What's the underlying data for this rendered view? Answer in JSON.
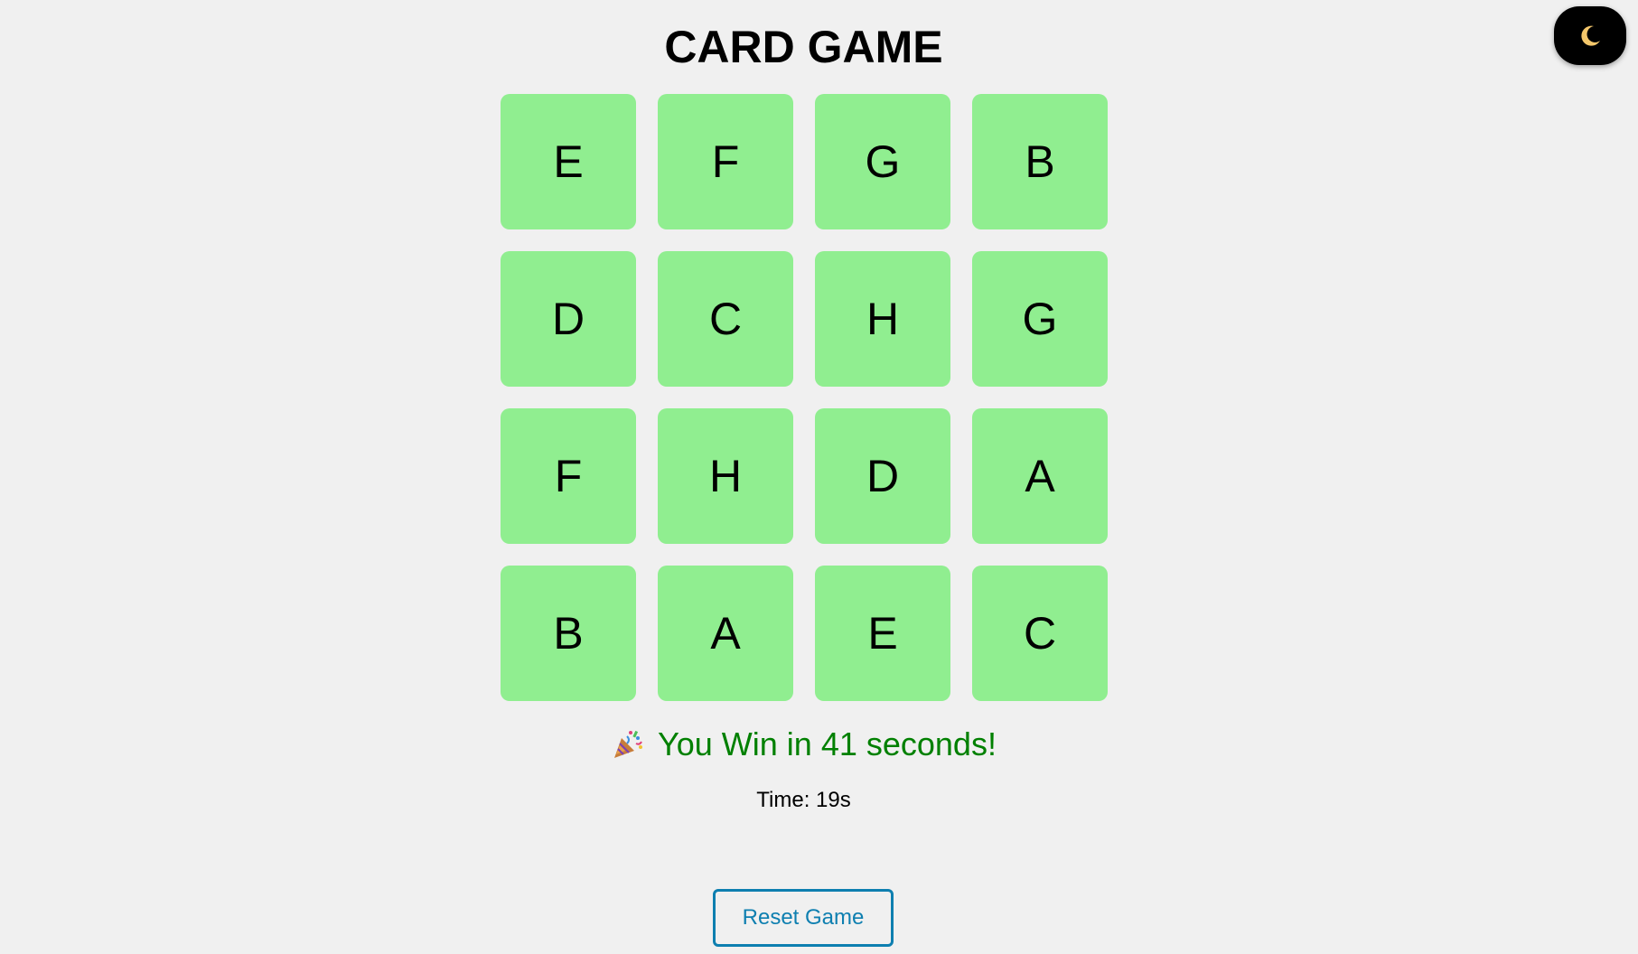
{
  "header": {
    "title": "CARD GAME"
  },
  "theme_toggle": {
    "icon": "moon-icon",
    "icon_color": "#f4c76b",
    "background": "#000000"
  },
  "board": {
    "card_color": "#90ee90",
    "cards": [
      "E",
      "F",
      "G",
      "B",
      "D",
      "C",
      "H",
      "G",
      "F",
      "H",
      "D",
      "A",
      "B",
      "A",
      "E",
      "C"
    ]
  },
  "status": {
    "icon": "party-popper-icon",
    "win_message": "You Win in 41 seconds!",
    "win_color": "#008000",
    "timer": "Time: 19s"
  },
  "controls": {
    "reset_label": "Reset Game",
    "reset_color": "#0e7fb0"
  }
}
